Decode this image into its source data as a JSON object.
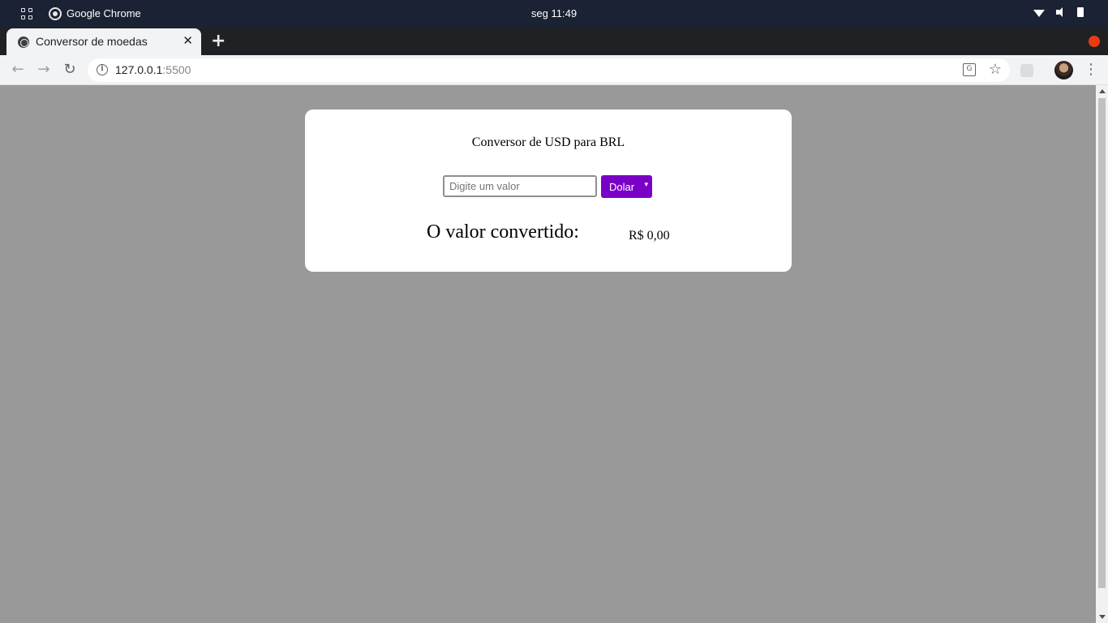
{
  "system": {
    "app_name": "Google Chrome",
    "clock": "seg 11:49"
  },
  "browser": {
    "tab_title": "Conversor de moedas",
    "tab_close": "✕",
    "new_tab": "+",
    "url_host": "127.0.0.1",
    "url_port": ":5500",
    "back": "←",
    "forward": "→",
    "reload": "↻",
    "star": "☆",
    "menu": "⋮"
  },
  "page": {
    "title": "Conversor de USD para BRL",
    "amount_input": {
      "value": "",
      "placeholder": "Digite um valor"
    },
    "currency_select": {
      "selected": "Dolar",
      "caret": "▾"
    },
    "result_label": "O valor convertido:",
    "result_value": "R$ 0,00"
  },
  "colors": {
    "page_background": "#999999",
    "accent_purple": "#7b00c7"
  }
}
